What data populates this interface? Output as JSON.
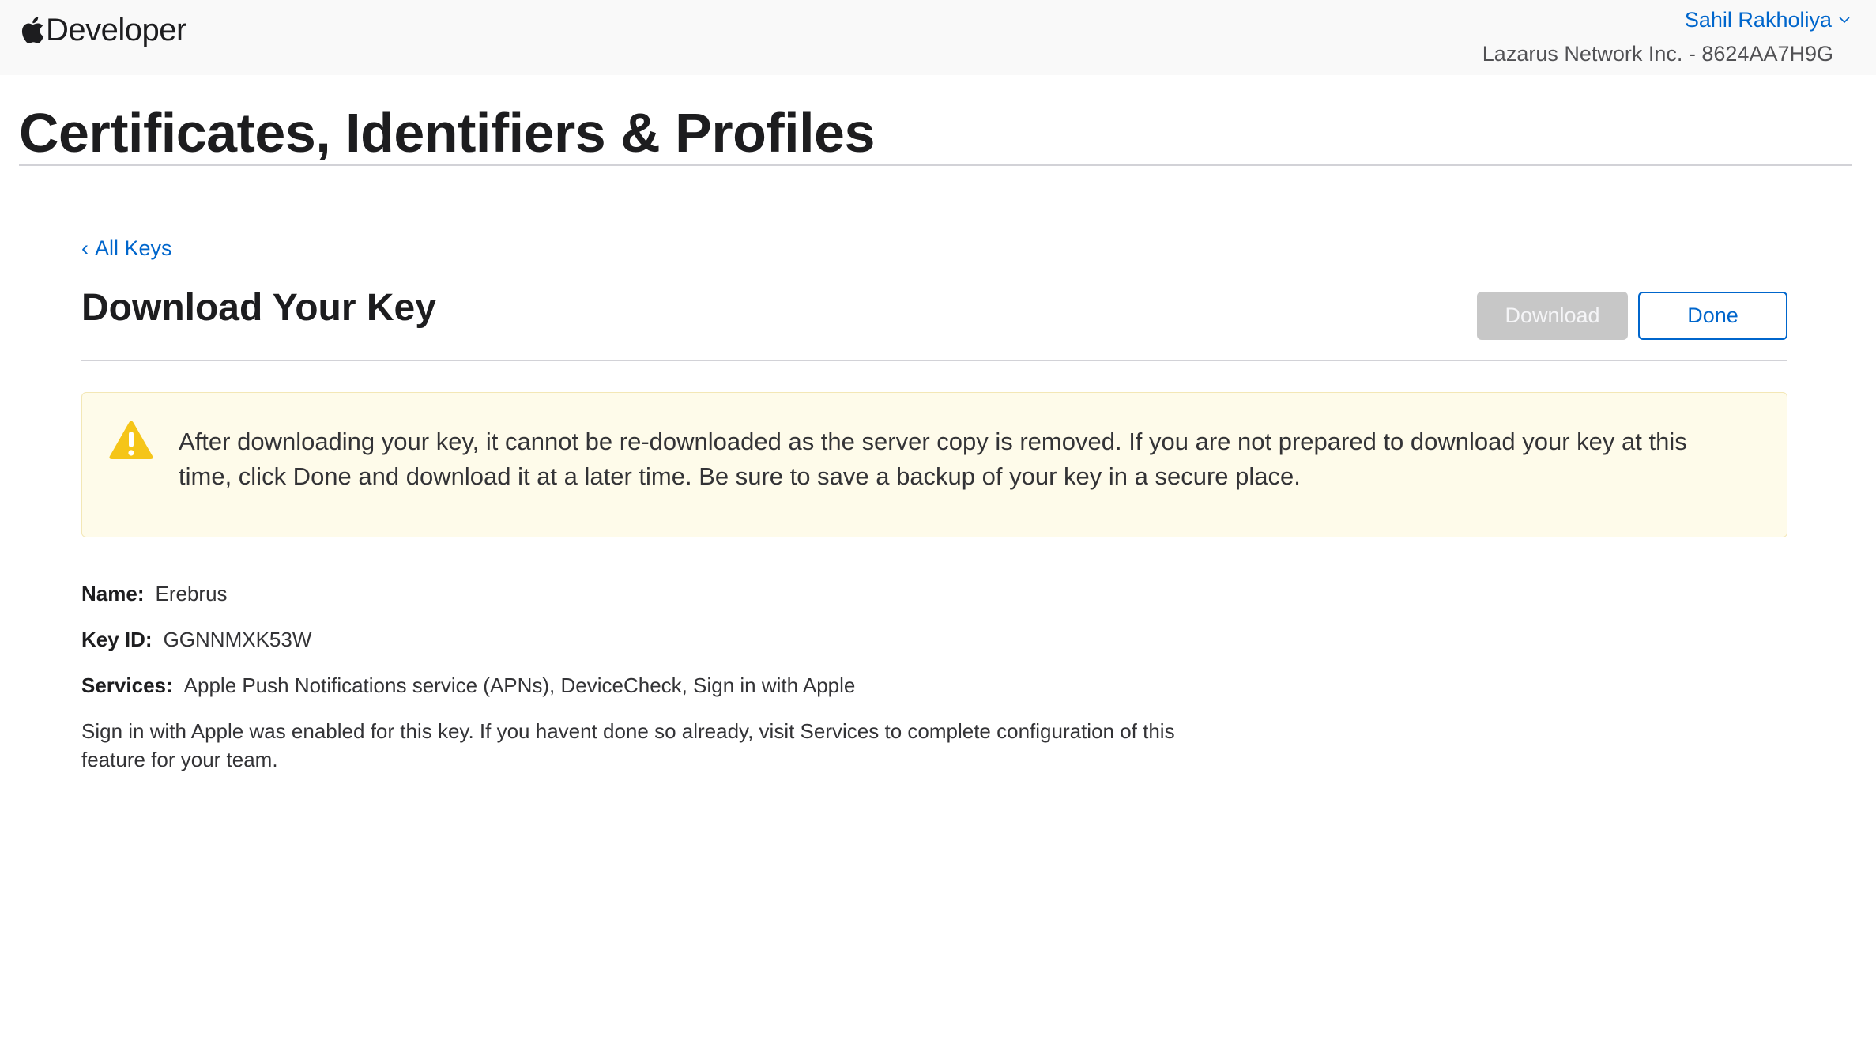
{
  "header": {
    "brand": "Developer",
    "brand_icon": "apple-logo-icon",
    "account": {
      "user_name": "Sahil Rakholiya",
      "team": "Lazarus Network Inc. - 8624AA7H9G"
    }
  },
  "page": {
    "title": "Certificates, Identifiers & Profiles"
  },
  "main": {
    "back_link": {
      "chevron": "‹",
      "label": "All Keys"
    },
    "section_title": "Download Your Key",
    "buttons": {
      "download_label": "Download",
      "done_label": "Done"
    },
    "notice": {
      "icon": "warning-icon",
      "text": "After downloading your key, it cannot be re-downloaded as the server copy is removed. If you are not prepared to download your key at this time, click Done and download it at a later time. Be sure to save a backup of your key in a secure place."
    },
    "details": {
      "name_label": "Name:",
      "name_value": "Erebrus",
      "key_id_label": "Key ID:",
      "key_id_value": "GGNNMXK53W",
      "services_label": "Services:",
      "services_value": "Apple Push Notifications service (APNs), DeviceCheck, Sign in with Apple",
      "note": "Sign in with Apple was enabled for this key. If you havent done so already, visit Services to complete configuration of this feature for your team."
    }
  },
  "colors": {
    "link": "#0066cc",
    "header_bg": "#f9f9f9",
    "notice_bg": "#fefbea",
    "warning": "#f5c518",
    "disabled_button": "#c7c7c7"
  }
}
